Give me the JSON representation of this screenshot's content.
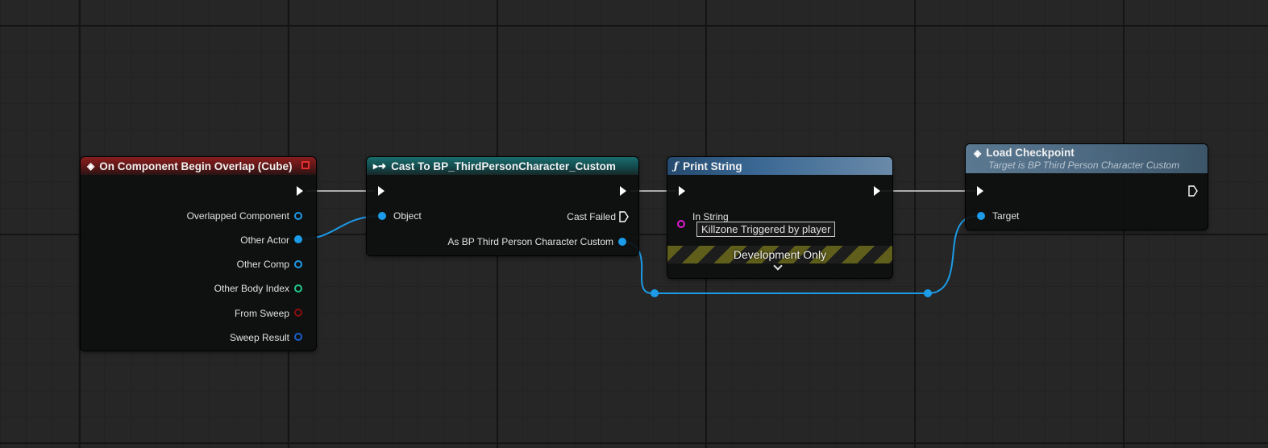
{
  "colors": {
    "object_pin": "#1c9be8",
    "struct_pin": "#1a5fc8",
    "int_pin": "#22c88a",
    "bool_pin": "#8a0e0e",
    "string_pin": "#e01bd2",
    "exec": "#ffffff"
  },
  "nodes": {
    "event": {
      "title": "On Component Begin Overlap (Cube)",
      "icon": "diamond-event-icon",
      "pins": [
        "Overlapped Component",
        "Other Actor",
        "Other Comp",
        "Other Body Index",
        "From Sweep",
        "Sweep Result"
      ]
    },
    "cast": {
      "title": "Cast To BP_ThirdPersonCharacter_Custom",
      "icon": "cast-arrow-icon",
      "object_label": "Object",
      "cast_failed_label": "Cast Failed",
      "as_label": "As BP Third Person Character Custom"
    },
    "print": {
      "title": "Print String",
      "icon": "function-f-icon",
      "in_string_label": "In String",
      "in_string_value": "Killzone Triggered by player",
      "dev_only_label": "Development Only",
      "expand_icon": "chevron-down-icon"
    },
    "load": {
      "title": "Load Checkpoint",
      "subtitle": "Target is BP Third Person Character Custom",
      "icon": "diamond-event-icon",
      "target_label": "Target"
    }
  }
}
